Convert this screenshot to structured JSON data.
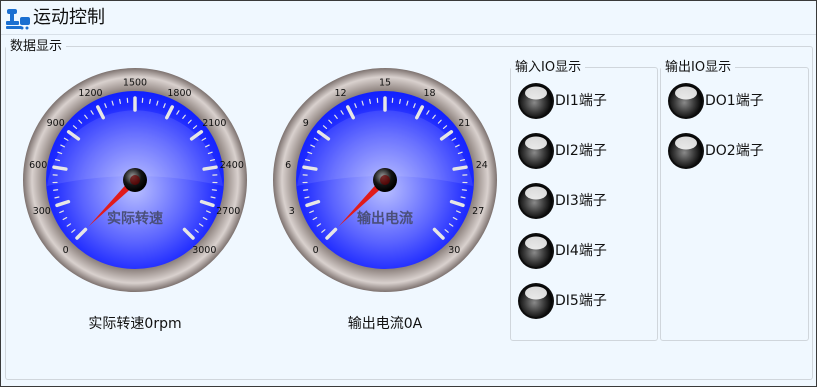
{
  "window": {
    "title": "运动控制"
  },
  "group": {
    "title": "数据显示"
  },
  "gauges": [
    {
      "center_label": "实际转速",
      "caption": "实际转速0rpm",
      "value": 0,
      "min": 0,
      "max": 3000,
      "ticks": [
        "0",
        "300",
        "600",
        "900",
        "1200",
        "1500",
        "1800",
        "2100",
        "2400",
        "2700",
        "3000"
      ]
    },
    {
      "center_label": "输出电流",
      "caption": "输出电流0A",
      "value": 0,
      "min": 0,
      "max": 30,
      "ticks": [
        "0",
        "3",
        "6",
        "9",
        "12",
        "15",
        "18",
        "21",
        "24",
        "27",
        "30"
      ]
    }
  ],
  "inputs": {
    "title": "输入IO显示",
    "items": [
      "DI1端子",
      "DI2端子",
      "DI3端子",
      "DI4端子",
      "DI5端子"
    ]
  },
  "outputs": {
    "title": "输出IO显示",
    "items": [
      "DO1端子",
      "DO2端子"
    ]
  },
  "colors": {
    "dial_face": "#1f2bff",
    "needle": "#e11b1b",
    "bezel": "#a89c98",
    "background": "#f0f8ff"
  }
}
